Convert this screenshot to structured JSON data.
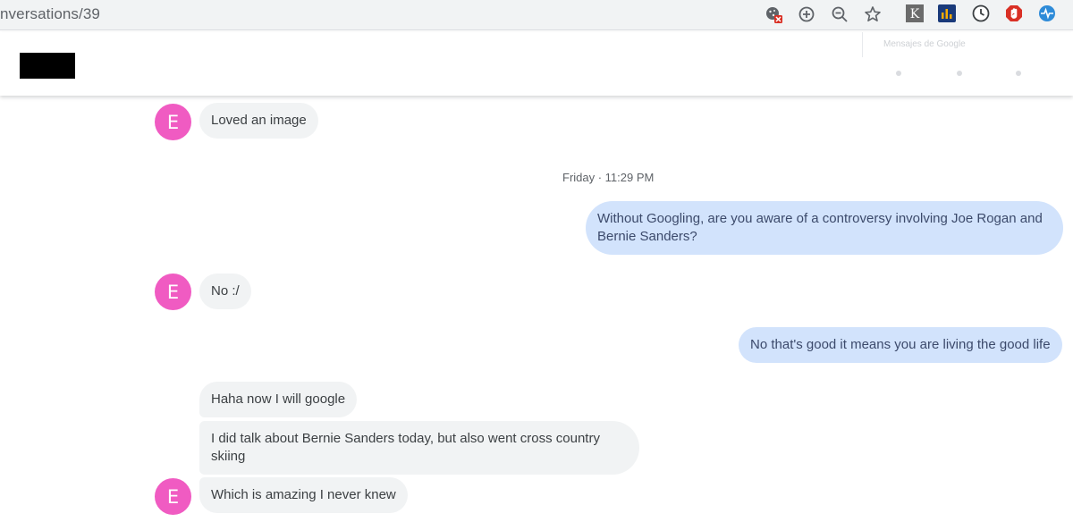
{
  "browser": {
    "url_fragment": "nversations/39",
    "icons": [
      "blocked-cookie-icon",
      "zoom-in-icon",
      "zoom-out-icon",
      "star-bookmark-icon"
    ],
    "extensions": [
      "k-extension-icon",
      "chart-extension-icon",
      "clock-extension-icon",
      "adblock-extension-icon",
      "pulse-extension-icon"
    ]
  },
  "header": {
    "ghost_text": "Mensajes de Google"
  },
  "messages": [
    {
      "side": "in",
      "text": "Loved an image",
      "avatar": "E"
    },
    {
      "side": "out",
      "text": "Without Googling, are you aware of a controversy involving Joe Rogan and Bernie Sanders?"
    },
    {
      "side": "in",
      "text": "No :/",
      "avatar": "E"
    },
    {
      "side": "out",
      "text": "No that's good it means you are living the good life"
    },
    {
      "side": "in",
      "text": "Haha now I will google"
    },
    {
      "side": "in",
      "text": "I did talk about Bernie Sanders today, but also went cross country skiing"
    },
    {
      "side": "in",
      "text": "Which is amazing I never knew",
      "avatar": "E"
    }
  ],
  "timestamp": "Friday · 11:29 PM",
  "colors": {
    "avatar": "#f05bc2",
    "incoming_bubble": "#f1f3f4",
    "outgoing_bubble": "#d2e3fc"
  }
}
